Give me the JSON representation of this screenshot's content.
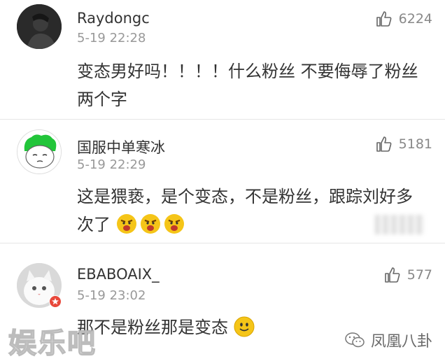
{
  "comments": [
    {
      "username": "Raydongc",
      "time": "5-19 22:28",
      "likes": "6224",
      "text": "变态男好吗！！！！什么粉丝 不要侮辱了粉丝两个字"
    },
    {
      "username": "国服中单寒冰",
      "time": "5-19 22:29",
      "likes": "5181",
      "text": "这是猥亵，是个变态，不是粉丝，跟踪刘好多次了"
    },
    {
      "username": "EBABOAIX_",
      "time": "5-19 23:02",
      "likes": "577",
      "text": "那不是粉丝那是变态"
    }
  ],
  "watermarks": {
    "left": "娱乐吧",
    "right": "凤凰八卦"
  },
  "colors": {
    "accent_green": "#22c53a",
    "text": "#333333",
    "meta": "#999999",
    "emoji_yellow": "#f5c518"
  }
}
